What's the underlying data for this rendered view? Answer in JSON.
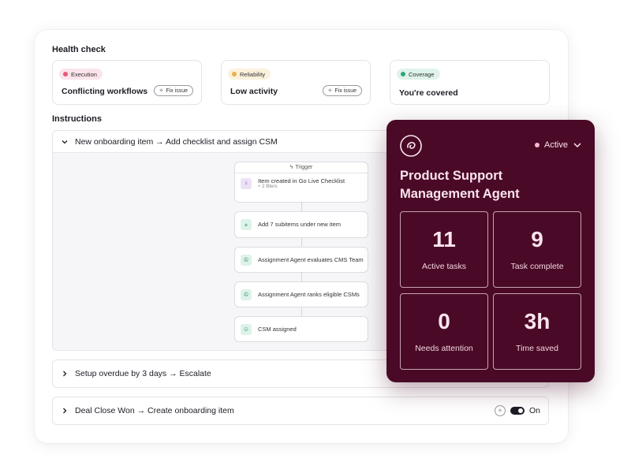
{
  "health_check": {
    "title": "Health check",
    "cards": [
      {
        "badge": "Execution",
        "badge_color": "#e8577a",
        "badge_bg": "#fbe4ea",
        "label": "Conflicting workflows",
        "button": "Fix issue"
      },
      {
        "badge": "Reliability",
        "badge_color": "#e8b04a",
        "badge_bg": "#fbf1dd",
        "label": "Low activity",
        "button": "Fix issue"
      },
      {
        "badge": "Coverage",
        "badge_color": "#2aa876",
        "badge_bg": "#dff3ea",
        "label": "You're covered"
      }
    ]
  },
  "instructions": {
    "title": "Instructions",
    "expanded": {
      "label": "New onboarding item → Add checklist and assign CSM",
      "trigger_label": "Trigger",
      "steps": [
        {
          "text": "Item created in Go Live Checklist",
          "sub": "+ 2 filters",
          "icon": "bulb-icon"
        },
        {
          "text": "Add 7 subitems under new item",
          "icon": "plus-icon"
        },
        {
          "text": "Assignment Agent evaluates CMS Team",
          "icon": "robot-icon"
        },
        {
          "text": "Assignment Agent ranks eligible CSMs",
          "icon": "robot-icon"
        },
        {
          "text": "CSM assigned",
          "icon": "user-icon"
        }
      ]
    },
    "collapsed": [
      {
        "label": "Setup overdue by 3 days → Escalate"
      },
      {
        "label": "Deal Close Won → Create onboarding item",
        "toggle_label": "On"
      }
    ]
  },
  "agent": {
    "status": "Active",
    "title": "Product Support Management Agent",
    "accent": "#4a0a27",
    "stats": [
      {
        "value": "11",
        "label": "Active tasks"
      },
      {
        "value": "9",
        "label": "Task complete"
      },
      {
        "value": "0",
        "label": "Needs attention"
      },
      {
        "value": "3h",
        "label": "Time saved"
      }
    ]
  }
}
